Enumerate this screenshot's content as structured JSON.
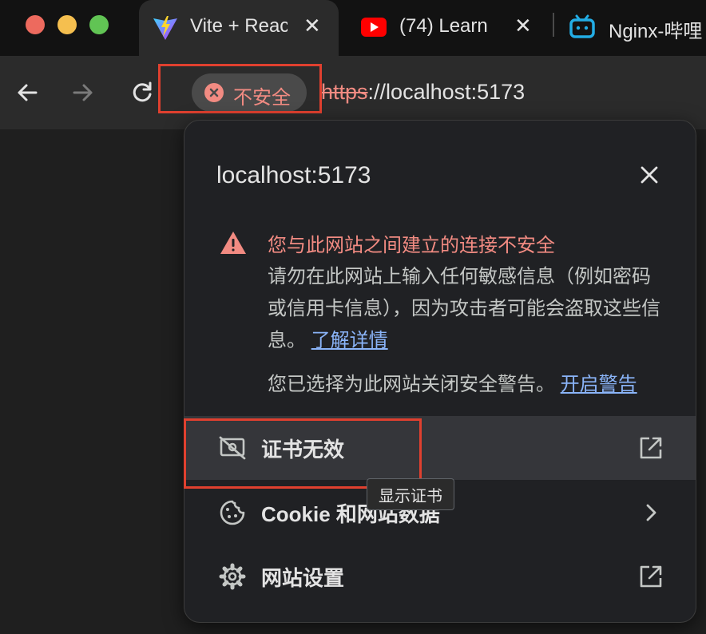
{
  "tabs": [
    {
      "title": "Vite + React",
      "icon": "vite-icon",
      "active": true
    },
    {
      "title": "(74) Learn",
      "icon": "youtube-icon",
      "active": false
    },
    {
      "title": "Nginx-哔哩",
      "icon": "bilibili-icon",
      "active": false
    }
  ],
  "toolbar": {
    "security_label": "不安全",
    "url_scheme": "https",
    "url_rest": "://localhost:5173"
  },
  "popup": {
    "title": "localhost:5173",
    "warning_heading": "您与此网站之间建立的连接不安全",
    "warning_body": "请勿在此网站上输入任何敏感信息（例如密码或信用卡信息），因为攻击者可能会盗取这些信息。",
    "learn_more": "了解详情",
    "warning_note": "您已选择为此网站关闭安全警告。",
    "enable_warnings": "开启警告",
    "items": [
      {
        "label": "证书无效",
        "icon": "certificate-invalid-icon",
        "trailing": "external-link-icon"
      },
      {
        "label": "Cookie 和网站数据",
        "icon": "cookie-icon",
        "trailing": "chevron-right-icon"
      },
      {
        "label": "网站设置",
        "icon": "gear-icon",
        "trailing": "external-link-icon"
      }
    ],
    "tooltip": "显示证书"
  },
  "colors": {
    "warning": "#f28b82",
    "link": "#8ab4f8",
    "annotation_box": "#e0402f"
  }
}
